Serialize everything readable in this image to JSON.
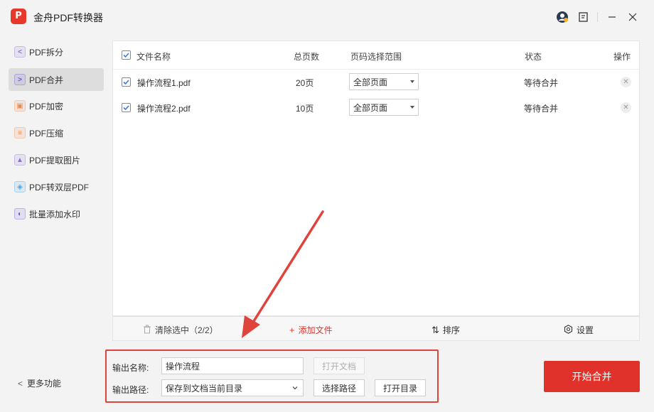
{
  "app": {
    "title": "金舟PDF转换器",
    "logo_text": "P"
  },
  "window_controls": {
    "user_icon": "user-avatar-icon",
    "feedback_icon": "feedback-icon",
    "minimize": "—",
    "close": "✕"
  },
  "sidebar": {
    "items": [
      {
        "label": "PDF拆分",
        "icon": "split-icon",
        "color": "#8b6fd8",
        "glyph": "<"
      },
      {
        "label": "PDF合并",
        "icon": "merge-icon",
        "color": "#6a5ad8",
        "glyph": ">"
      },
      {
        "label": "PDF加密",
        "icon": "lock-icon",
        "color": "#f08a4b",
        "glyph": "▣"
      },
      {
        "label": "PDF压缩",
        "icon": "compress-icon",
        "color": "#f08a4b",
        "glyph": "≡"
      },
      {
        "label": "PDF提取图片",
        "icon": "image-icon",
        "color": "#8b6fd8",
        "glyph": "▲"
      },
      {
        "label": "PDF转双层PDF",
        "icon": "layers-icon",
        "color": "#4aa3e8",
        "glyph": "◈"
      },
      {
        "label": "批量添加水印",
        "icon": "watermark-icon",
        "color": "#6a5ad8",
        "glyph": "◐"
      }
    ],
    "active_index": 1,
    "more_label": "更多功能"
  },
  "table": {
    "headers": {
      "name": "文件名称",
      "pages": "总页数",
      "range": "页码选择范围",
      "status": "状态",
      "action": "操作"
    },
    "rows": [
      {
        "name": "操作流程1.pdf",
        "pages": "20页",
        "range": "全部页面",
        "status": "等待合并"
      },
      {
        "name": "操作流程2.pdf",
        "pages": "10页",
        "range": "全部页面",
        "status": "等待合并"
      }
    ]
  },
  "toolbar": {
    "clear_label": "清除选中（2/2）",
    "add_label": "添加文件",
    "sort_label": "排序",
    "settings_label": "设置"
  },
  "output": {
    "name_label": "输出名称:",
    "name_value": "操作流程",
    "open_doc_label": "打开文档",
    "path_label": "输出路径:",
    "path_value": "保存到文档当前目录",
    "choose_path_label": "选择路径",
    "open_dir_label": "打开目录"
  },
  "start_button": {
    "label": "开始合并"
  },
  "colors": {
    "accent": "#e0322a",
    "checkbox": "#5a8fe6",
    "annotation": "#e0433b"
  }
}
